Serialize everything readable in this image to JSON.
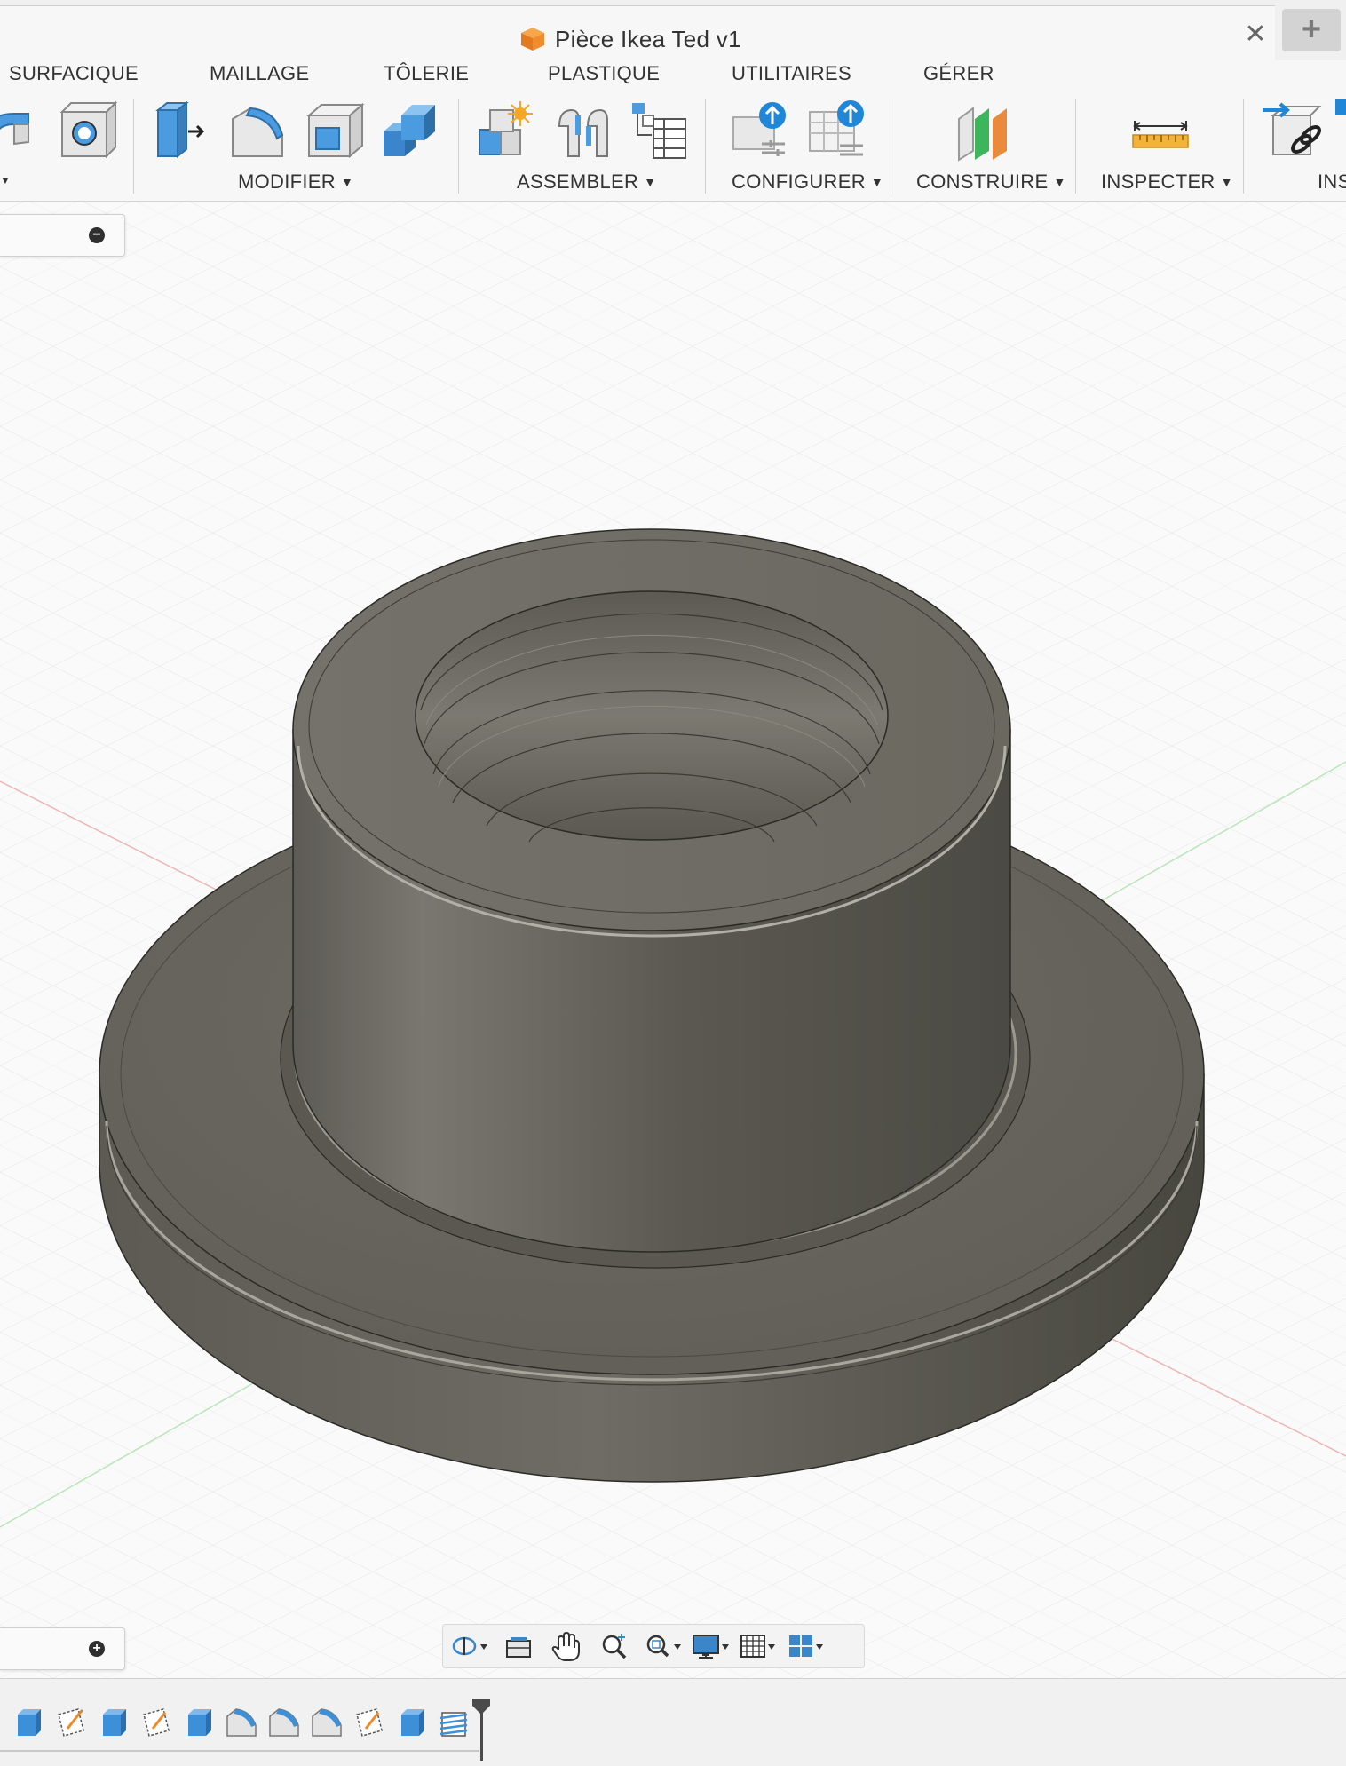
{
  "window": {
    "title": "Pièce Ikea Ted v1",
    "close_symbol": "✕",
    "new_tab_symbol": "+",
    "doc_icon": "orange-part-cube-icon"
  },
  "toolbar": {
    "tabs": [
      "SURFACIQUE",
      "MAILLAGE",
      "TÔLERIE",
      "PLASTIQUE",
      "UTILITAIRES",
      "GÉRER"
    ],
    "groups": {
      "modify": "MODIFIER",
      "assemble": "ASSEMBLER",
      "configure": "CONFIGURER",
      "construct": "CONSTRUIRE",
      "inspect": "INSPECTER",
      "insert": "INS"
    },
    "caret": "▼",
    "icons": [
      "surface-patch-icon",
      "boundary-fill-icon",
      "press-pull-icon",
      "fillet-icon",
      "shell-icon",
      "combine-icon",
      "new-component-icon",
      "joint-icon",
      "bill-of-materials-icon",
      "configure-icon",
      "configure-table-icon",
      "offset-plane-icon",
      "measure-icon",
      "insert-derive-icon"
    ]
  },
  "panels": {
    "browser_toggle": "−",
    "comments_toggle": "+"
  },
  "navigation": {
    "tools": [
      "orbit-icon",
      "look-at-icon",
      "pan-icon",
      "zoom-icon",
      "fit-icon",
      "display-settings-icon",
      "grid-icon",
      "viewports-icon"
    ]
  },
  "timeline": {
    "features": [
      "extrude-icon",
      "sketch-icon",
      "extrude-icon",
      "sketch-icon",
      "extrude-icon",
      "fillet-icon",
      "fillet-icon",
      "fillet-icon",
      "sketch-icon",
      "extrude-icon",
      "thread-icon"
    ]
  },
  "colors": {
    "accent_blue": "#3b8fd6",
    "model_grey": "#6b6960",
    "toolbar_bg": "#f7f7f7",
    "axis_red": "#e79a9a",
    "axis_green": "#9fd99f"
  }
}
